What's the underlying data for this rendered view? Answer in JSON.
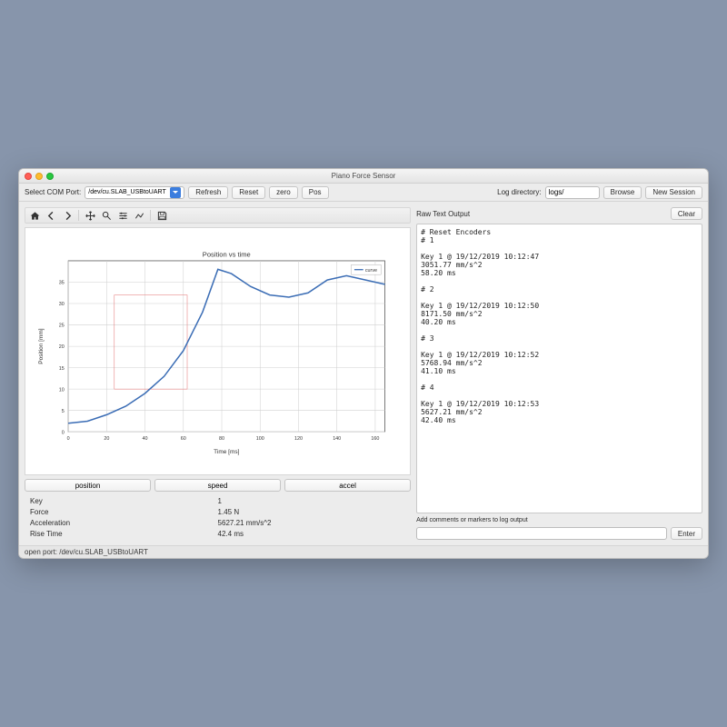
{
  "window": {
    "title": "Piano Force Sensor"
  },
  "toolbar": {
    "port_label": "Select COM Port:",
    "port_value": "/dev/cu.SLAB_USBtoUART",
    "refresh": "Refresh",
    "reset": "Reset",
    "zero": "zero",
    "pos": "Pos",
    "logdir_label": "Log directory:",
    "logdir_value": "logs/",
    "browse": "Browse",
    "new_session": "New Session"
  },
  "tabs": {
    "position": "position",
    "speed": "speed",
    "accel": "accel"
  },
  "stats": {
    "key_label": "Key",
    "key_value": "1",
    "force_label": "Force",
    "force_value": "1.45 N",
    "accel_label": "Acceleration",
    "accel_value": "5627.21 mm/s^2",
    "rise_label": "Rise Time",
    "rise_value": "42.4 ms"
  },
  "raw": {
    "heading": "Raw Text Output",
    "clear": "Clear",
    "text": "# Reset Encoders\n# 1\n\nKey 1 @ 19/12/2019 10:12:47\n3051.77 mm/s^2\n58.20 ms\n\n# 2\n\nKey 1 @ 19/12/2019 10:12:50\n8171.50 mm/s^2\n40.20 ms\n\n# 3\n\nKey 1 @ 19/12/2019 10:12:52\n5768.94 mm/s^2\n41.10 ms\n\n# 4\n\nKey 1 @ 19/12/2019 10:12:53\n5627.21 mm/s^2\n42.40 ms",
    "comment_label": "Add comments or markers to log output",
    "enter": "Enter"
  },
  "status": "open port: /dev/cu.SLAB_USBtoUART",
  "chart_data": {
    "type": "line",
    "title": "Position vs time",
    "xlabel": "Time [ms]",
    "ylabel": "Position [mm]",
    "xlim": [
      0,
      165
    ],
    "ylim": [
      0,
      40
    ],
    "xticks": [
      0,
      20,
      40,
      60,
      80,
      100,
      120,
      140,
      160
    ],
    "yticks": [
      0,
      5,
      10,
      15,
      20,
      25,
      30,
      35
    ],
    "legend": [
      "curve"
    ],
    "series": [
      {
        "name": "curve",
        "x": [
          0,
          10,
          20,
          30,
          40,
          50,
          60,
          70,
          78,
          85,
          95,
          105,
          115,
          125,
          135,
          145,
          155,
          165
        ],
        "values": [
          2,
          2.5,
          4,
          6,
          9,
          13,
          19,
          28,
          38,
          37,
          34,
          32,
          31.5,
          32.5,
          35.5,
          36.5,
          35.5,
          34.5
        ]
      }
    ],
    "zoom_rect": {
      "x0": 24,
      "x1": 62,
      "y0": 10,
      "y1": 32
    }
  }
}
